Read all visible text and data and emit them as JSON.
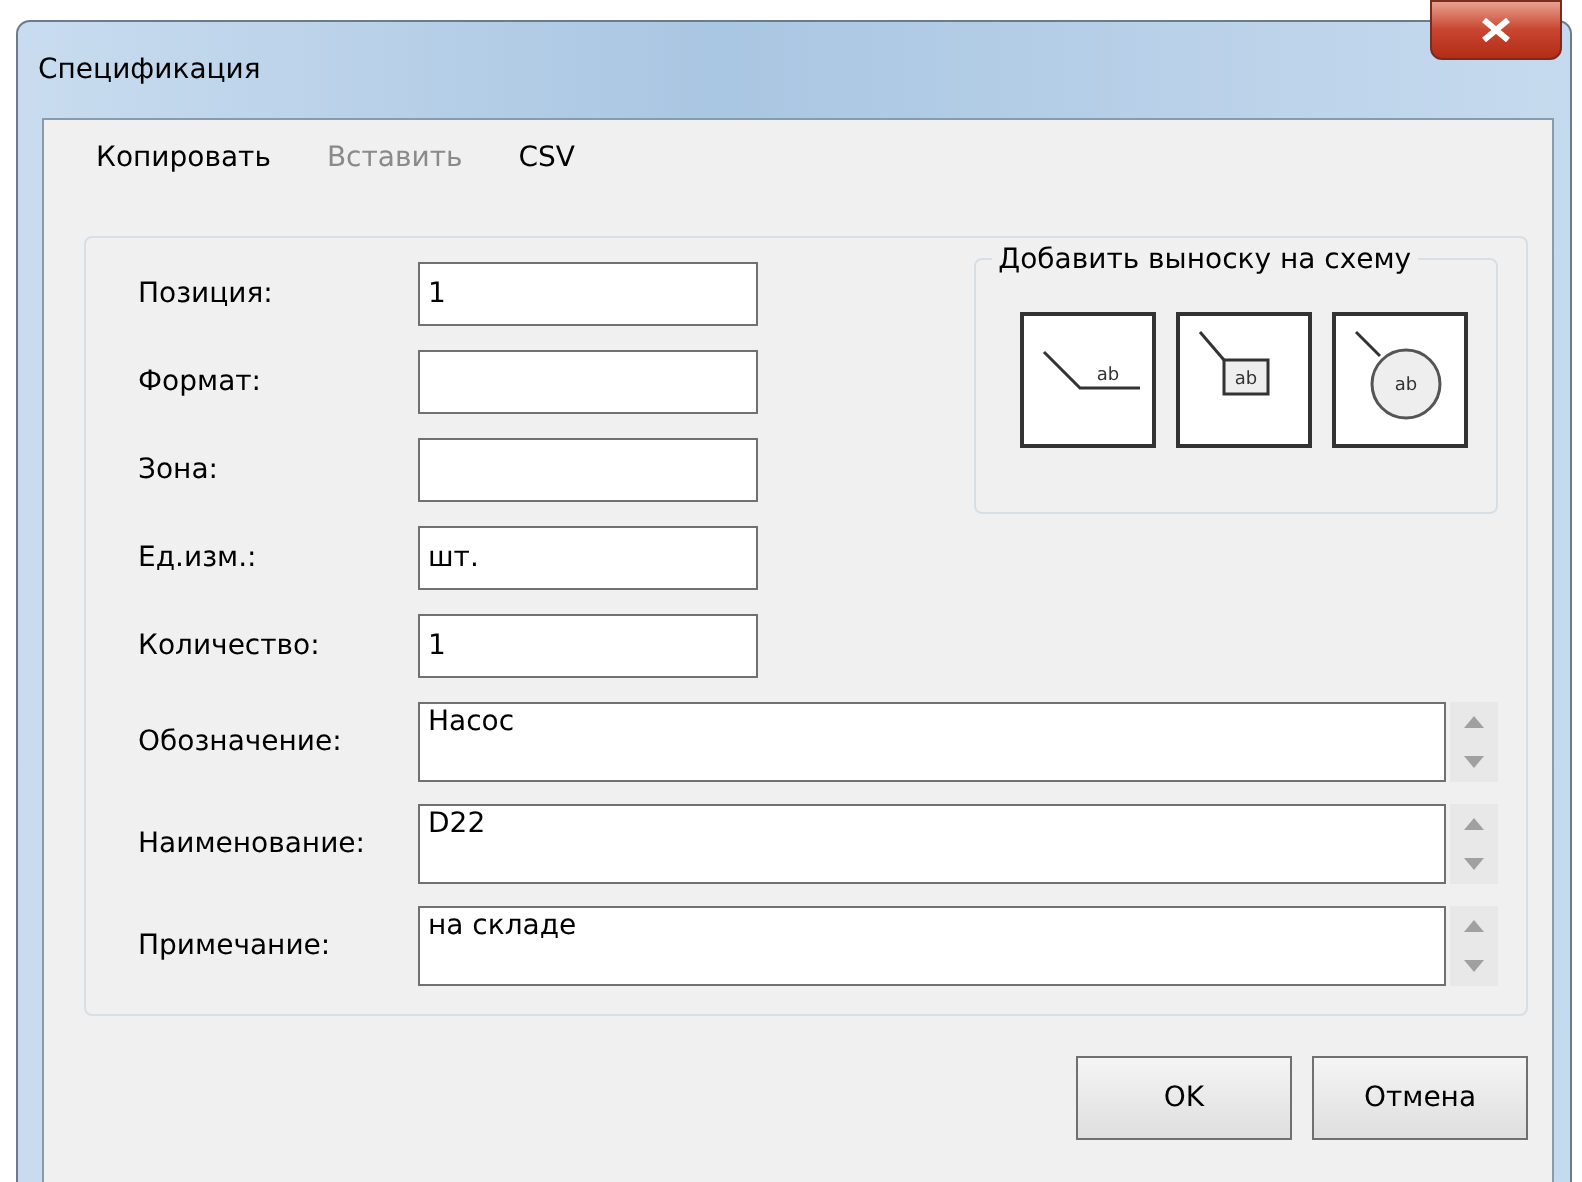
{
  "window": {
    "title": "Спецификация"
  },
  "menu": [
    {
      "label": "Копировать",
      "disabled": false
    },
    {
      "label": "Вставить",
      "disabled": true
    },
    {
      "label": "CSV",
      "disabled": false
    }
  ],
  "fields": [
    {
      "kind": "short",
      "label": "Позиция:",
      "value": "1"
    },
    {
      "kind": "short",
      "label": "Формат:"
    },
    {
      "kind": "short",
      "label": "Зона:"
    },
    {
      "kind": "short",
      "label": "Ед.изм.:",
      "value": "шт."
    },
    {
      "kind": "short",
      "label": "Количество:",
      "value": "1"
    },
    {
      "kind": "multiline",
      "label": "Обозначение:",
      "value": "Насос"
    },
    {
      "kind": "multiline",
      "label": "Наименование:",
      "value": "D22"
    },
    {
      "kind": "multiline",
      "label": "Примечание:",
      "value": "на складе"
    }
  ],
  "callout_group": {
    "title": "Добавить выноску на схему",
    "buttons": [
      {
        "kind": "shelf",
        "text": "ab"
      },
      {
        "kind": "box",
        "text": "ab"
      },
      {
        "kind": "circle",
        "text": "ab"
      }
    ]
  },
  "buttons": [
    {
      "label": "OK"
    },
    {
      "label": "Отмена"
    }
  ]
}
